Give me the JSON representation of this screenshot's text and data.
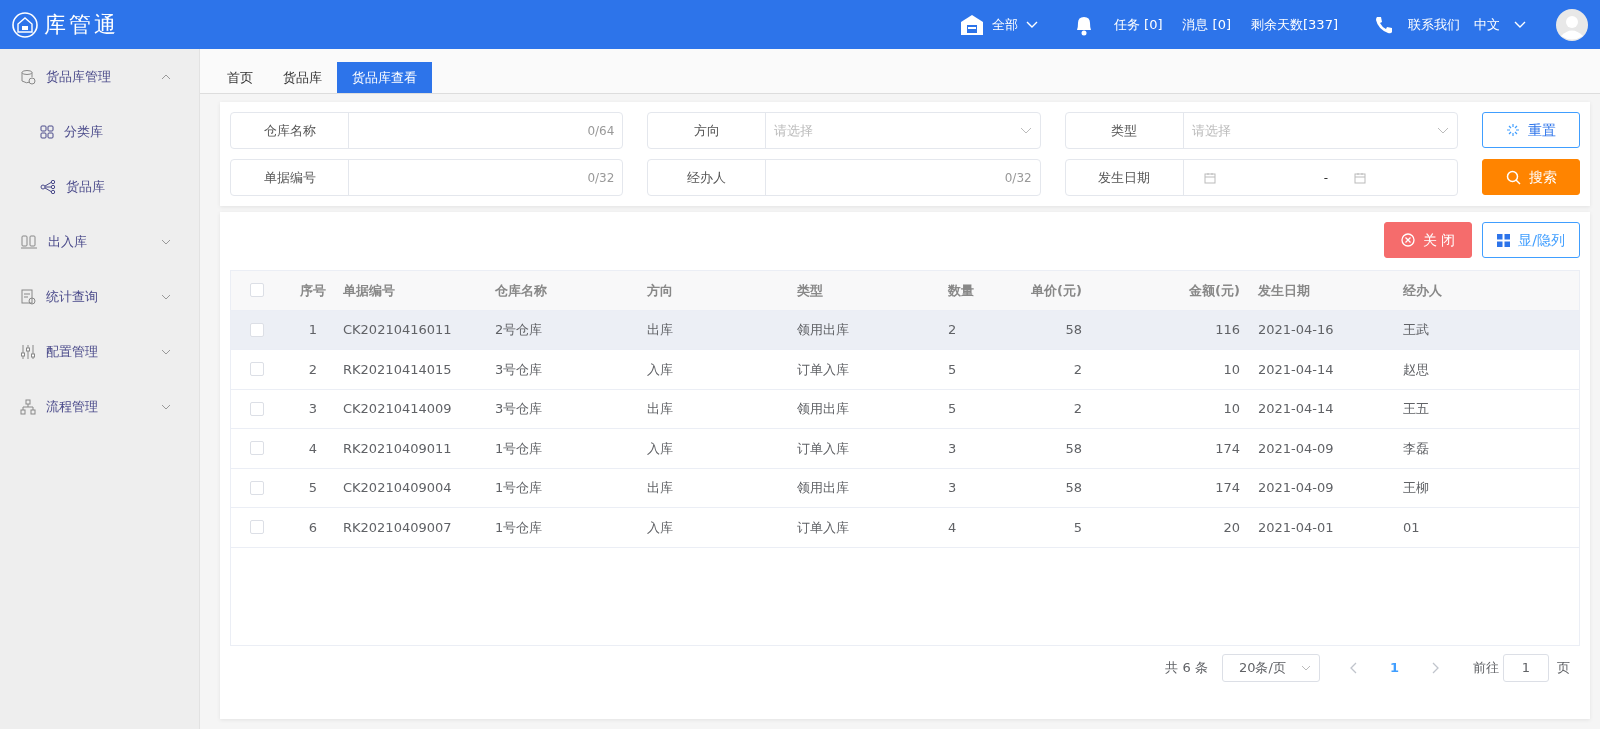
{
  "header": {
    "logo": "库管通",
    "warehouse": "全部",
    "tasks": "任务 [0]",
    "messages": "消息 [0]",
    "days_left": "剩余天数[337]",
    "contact": "联系我们",
    "language": "中文"
  },
  "sidebar": {
    "items": [
      {
        "label": "货品库管理",
        "expanded": true,
        "children": [
          {
            "label": "分类库"
          },
          {
            "label": "货品库"
          }
        ]
      },
      {
        "label": "出入库",
        "expanded": false
      },
      {
        "label": "统计查询",
        "expanded": false
      },
      {
        "label": "配置管理",
        "expanded": false
      },
      {
        "label": "流程管理",
        "expanded": false
      }
    ]
  },
  "tabs": [
    {
      "label": "首页",
      "selected": false
    },
    {
      "label": "货品库",
      "selected": false
    },
    {
      "label": "货品库查看",
      "selected": true
    }
  ],
  "filters": [
    {
      "kind": "text",
      "label": "仓库名称",
      "counter": "0/64"
    },
    {
      "kind": "select",
      "label": "方向",
      "placeholder": "请选择"
    },
    {
      "kind": "select",
      "label": "类型",
      "placeholder": "请选择"
    },
    {
      "kind": "text",
      "label": "单据编号",
      "counter": "0/32"
    },
    {
      "kind": "text",
      "label": "经办人",
      "counter": "0/32"
    },
    {
      "kind": "daterange",
      "label": "发生日期",
      "separator": "-"
    }
  ],
  "filter_buttons": {
    "reset": "重置",
    "search": "搜索"
  },
  "toolbar": {
    "close": "关 闭",
    "columns": "显/隐列"
  },
  "table": {
    "select_all_checked": false,
    "columns": [
      "序号",
      "单据编号",
      "仓库名称",
      "方向",
      "类型",
      "数量",
      "单价(元)",
      "金额(元)",
      "发生日期",
      "经办人"
    ],
    "rows": [
      {
        "hovered": true,
        "checked": false,
        "cells": [
          "1",
          "CK20210416011",
          "2号仓库",
          "出库",
          "领用出库",
          "2",
          "58",
          "116",
          "2021-04-16",
          "王武"
        ]
      },
      {
        "hovered": false,
        "checked": false,
        "cells": [
          "2",
          "RK20210414015",
          "3号仓库",
          "入库",
          "订单入库",
          "5",
          "2",
          "10",
          "2021-04-14",
          "赵思"
        ]
      },
      {
        "hovered": false,
        "checked": false,
        "cells": [
          "3",
          "CK20210414009",
          "3号仓库",
          "出库",
          "领用出库",
          "5",
          "2",
          "10",
          "2021-04-14",
          "王五"
        ]
      },
      {
        "hovered": false,
        "checked": false,
        "cells": [
          "4",
          "RK20210409011",
          "1号仓库",
          "入库",
          "订单入库",
          "3",
          "58",
          "174",
          "2021-04-09",
          "李磊"
        ]
      },
      {
        "hovered": false,
        "checked": false,
        "cells": [
          "5",
          "CK20210409004",
          "1号仓库",
          "出库",
          "领用出库",
          "3",
          "58",
          "174",
          "2021-04-09",
          "王柳"
        ]
      },
      {
        "hovered": false,
        "checked": false,
        "cells": [
          "6",
          "RK20210409007",
          "1号仓库",
          "入库",
          "订单入库",
          "4",
          "5",
          "20",
          "2021-04-01",
          "01"
        ]
      }
    ]
  },
  "pagination": {
    "total": "共 6 条",
    "page_size": "20条/页",
    "current_page": "1",
    "goto_label": "前往",
    "goto_value": "1",
    "page_suffix": "页"
  }
}
